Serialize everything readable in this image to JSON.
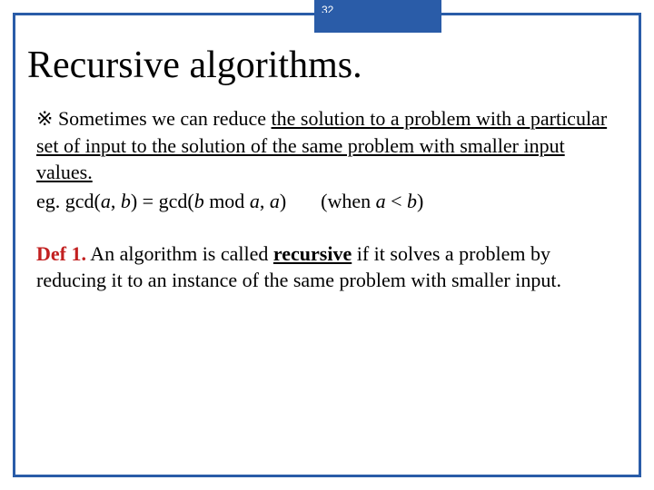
{
  "page_number": "32",
  "title": "Recursive algorithms.",
  "para1": {
    "marker": "※ ",
    "lead": "Sometimes we can reduce ",
    "ul_part": "the solution to a problem with a particular set of input to the solution of the same problem with smaller input values.",
    "eg_prefix": "eg.   gcd(",
    "a1": "a",
    "comma1": ", ",
    "b1": "b",
    "mid1": ") = gcd(",
    "b2": "b",
    "mod": " mod ",
    "a2": "a",
    "comma2": ", ",
    "a3": "a",
    "close1": ")",
    "when_open": "(when ",
    "a4": "a",
    "lt": " < ",
    "b3": "b",
    "when_close": ")"
  },
  "def": {
    "label": "Def 1.",
    "t1": "  An algorithm is called ",
    "recursive": "recursive",
    "t2": " if it solves a problem by reducing it to an instance of the same problem with smaller input."
  }
}
